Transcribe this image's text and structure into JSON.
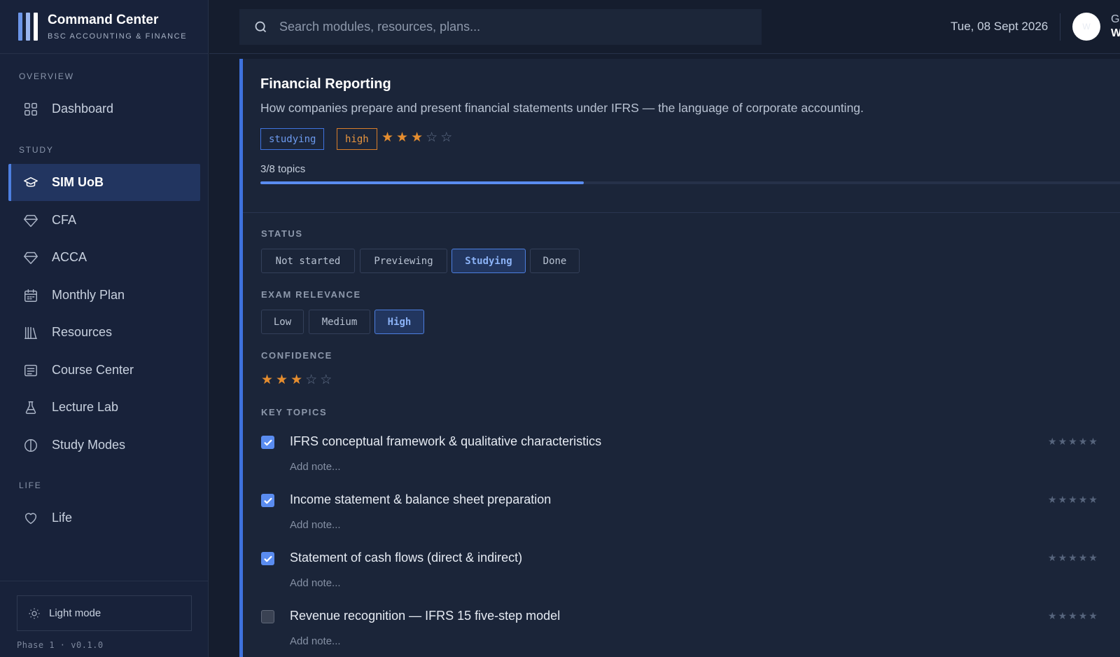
{
  "brand": {
    "title": "Command Center",
    "subtitle": "BSC ACCOUNTING & FINANCE"
  },
  "sidebar": {
    "sections": [
      {
        "label": "OVERVIEW"
      },
      {
        "label": "STUDY"
      },
      {
        "label": "LIFE"
      }
    ],
    "items": [
      {
        "label": "Dashboard",
        "icon": "grid-icon"
      },
      {
        "label": "SIM UoB",
        "icon": "graduation-cap-icon",
        "active": true
      },
      {
        "label": "CFA",
        "icon": "diamond-icon"
      },
      {
        "label": "ACCA",
        "icon": "diamond-icon"
      },
      {
        "label": "Monthly Plan",
        "icon": "calendar-icon"
      },
      {
        "label": "Resources",
        "icon": "library-icon"
      },
      {
        "label": "Course Center",
        "icon": "document-icon"
      },
      {
        "label": "Lecture Lab",
        "icon": "flask-icon"
      },
      {
        "label": "Study Modes",
        "icon": "half-circle-icon"
      },
      {
        "label": "Life",
        "icon": "heart-icon"
      }
    ],
    "footer": {
      "light_mode": "Light mode",
      "version": "Phase 1 · v0.1.0"
    }
  },
  "topbar": {
    "search_placeholder": "Search modules, resources, plans...",
    "date": "Tue, 08 Sept 2026",
    "avatar_text": "W",
    "user_line1": "G",
    "user_line2": "W"
  },
  "module": {
    "title": "Financial Reporting",
    "description": "How companies prepare and present financial statements under IFRS — the language of corporate accounting.",
    "status_tag": "studying",
    "relevance_tag": "high",
    "confidence": 3,
    "confidence_max": 5,
    "progress_label": "3/8 topics",
    "progress_fraction": 0.375
  },
  "status": {
    "label": "STATUS",
    "options": [
      "Not started",
      "Previewing",
      "Studying",
      "Done"
    ],
    "selected": "Studying"
  },
  "relevance": {
    "label": "EXAM RELEVANCE",
    "options": [
      "Low",
      "Medium",
      "High"
    ],
    "selected": "High"
  },
  "confidence": {
    "label": "CONFIDENCE",
    "value": 3,
    "max": 5
  },
  "topics": {
    "label": "KEY TOPICS",
    "note_placeholder": "Add note...",
    "items": [
      {
        "title": "IFRS conceptual framework & qualitative characteristics",
        "checked": true,
        "rating": 0
      },
      {
        "title": "Income statement & balance sheet preparation",
        "checked": true,
        "rating": 0
      },
      {
        "title": "Statement of cash flows (direct & indirect)",
        "checked": true,
        "rating": 0
      },
      {
        "title": "Revenue recognition — IFRS 15 five-step model",
        "checked": false,
        "rating": 0
      }
    ]
  },
  "colors": {
    "accent": "#3e72dd",
    "star": "#e58d2f",
    "warning": "#d97e2a",
    "background": "#151d2e"
  }
}
